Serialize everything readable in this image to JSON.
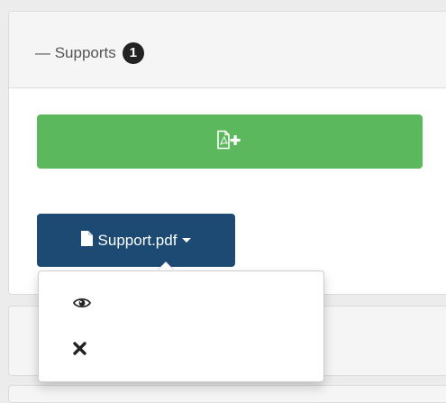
{
  "panel": {
    "title": "— Supports",
    "count": "1"
  },
  "add_button": {
    "icon": "file-pdf-plus-icon"
  },
  "file_button": {
    "icon": "file-icon",
    "label": "Support.pdf"
  },
  "dropdown": {
    "items": [
      {
        "icon": "eye-icon"
      },
      {
        "icon": "close-icon"
      }
    ]
  },
  "colors": {
    "success": "#5cb85c",
    "primary_dark": "#1c4a72",
    "badge": "#222222"
  }
}
